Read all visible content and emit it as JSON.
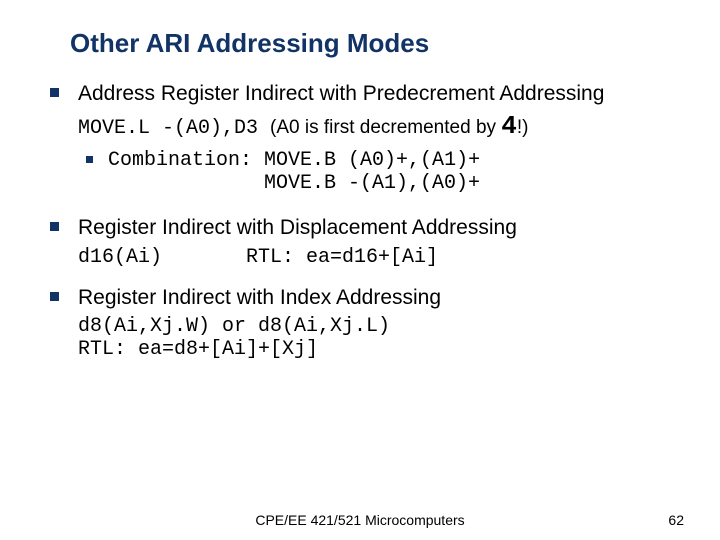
{
  "title": "Other ARI Addressing Modes",
  "items": [
    {
      "heading": "Address Register Indirect with Predecrement Addressing",
      "code1_a": "MOVE.L -(A0),D3 ",
      "code1_note_pre": "(A0 is first decremented by ",
      "code1_big": "4",
      "code1_note_post": "!)",
      "sub": {
        "label": "Combination:",
        "line1": " MOVE.B (A0)+,(A1)+",
        "line2": "             MOVE.B -(A1),(A0)+"
      }
    },
    {
      "heading": "Register Indirect with Displacement Addressing",
      "code_a": "d16(Ai)",
      "code_b": "       RTL: ea=d16+[Ai]"
    },
    {
      "heading": "Register Indirect with Index Addressing",
      "code_a": "d8(Ai,Xj.W) or d8(Ai,Xj.L)",
      "code_b": "RTL: ea=d8+[Ai]+[Xj]"
    }
  ],
  "footer": {
    "center": "CPE/EE 421/521 Microcomputers",
    "page": "62"
  }
}
